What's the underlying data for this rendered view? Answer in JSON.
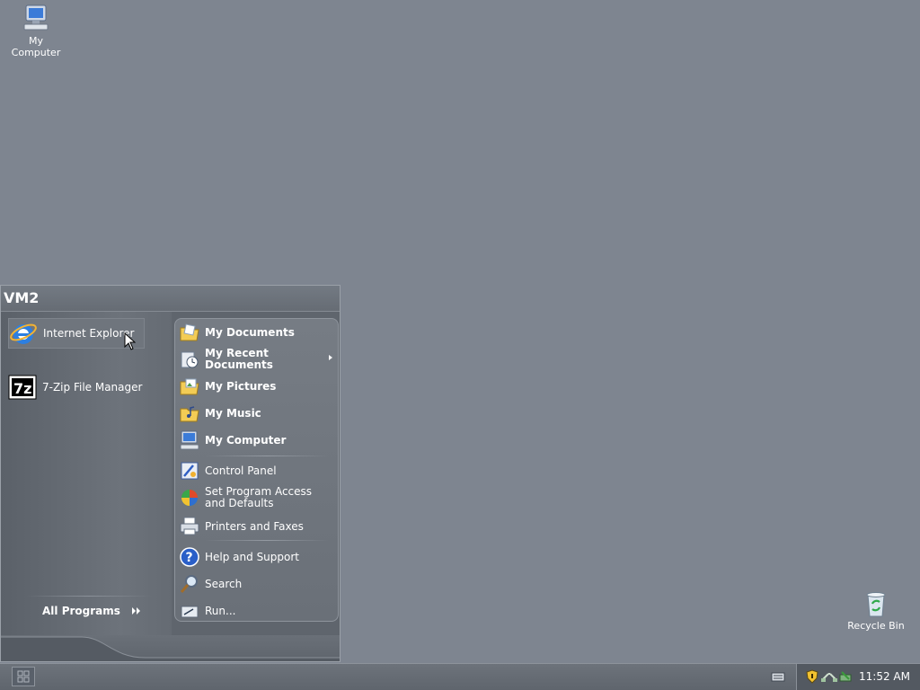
{
  "desktop": {
    "icons": [
      {
        "label": "My\nComputer",
        "line1": "My",
        "line2": "Computer",
        "icon": "my-computer-icon"
      },
      {
        "label": "Recycle Bin",
        "icon": "recycle-bin-icon"
      }
    ]
  },
  "start_menu": {
    "user_name": "VM2",
    "pinned": [
      {
        "label": "Internet Explorer",
        "icon": "internet-explorer-icon"
      },
      {
        "label": "7-Zip File Manager",
        "icon": "7zip-icon"
      }
    ],
    "all_programs_label": "All Programs",
    "right_pane": [
      {
        "label": "My Documents",
        "icon": "folder-icon",
        "bold": true
      },
      {
        "label_line1": "My Recent",
        "label_line2": "Documents",
        "icon": "recent-documents-icon",
        "bold": true,
        "has_submenu": true
      },
      {
        "label": "My Pictures",
        "icon": "pictures-folder-icon",
        "bold": true
      },
      {
        "label": "My Music",
        "icon": "music-folder-icon",
        "bold": true
      },
      {
        "label": "My Computer",
        "icon": "my-computer-icon",
        "bold": true
      },
      {
        "label": "Control Panel",
        "icon": "control-panel-icon",
        "bold": false
      },
      {
        "label_line1": "Set Program Access",
        "label_line2": "and Defaults",
        "icon": "program-access-icon",
        "bold": false
      },
      {
        "label": "Printers and Faxes",
        "icon": "printer-icon",
        "bold": false
      },
      {
        "label": "Help and Support",
        "icon": "help-icon",
        "bold": false
      },
      {
        "label": "Search",
        "icon": "search-icon",
        "bold": false
      },
      {
        "label": "Run...",
        "icon": "run-icon",
        "bold": false
      }
    ]
  },
  "taskbar": {
    "clock": "11:52 AM",
    "tray_icons": [
      "keyboard-icon",
      "security-shield-icon",
      "network-icon",
      "safely-remove-icon"
    ]
  },
  "colors": {
    "desktop_bg": "#7e8590",
    "menu_bg": "#5f656d",
    "text": "#ffffff"
  }
}
